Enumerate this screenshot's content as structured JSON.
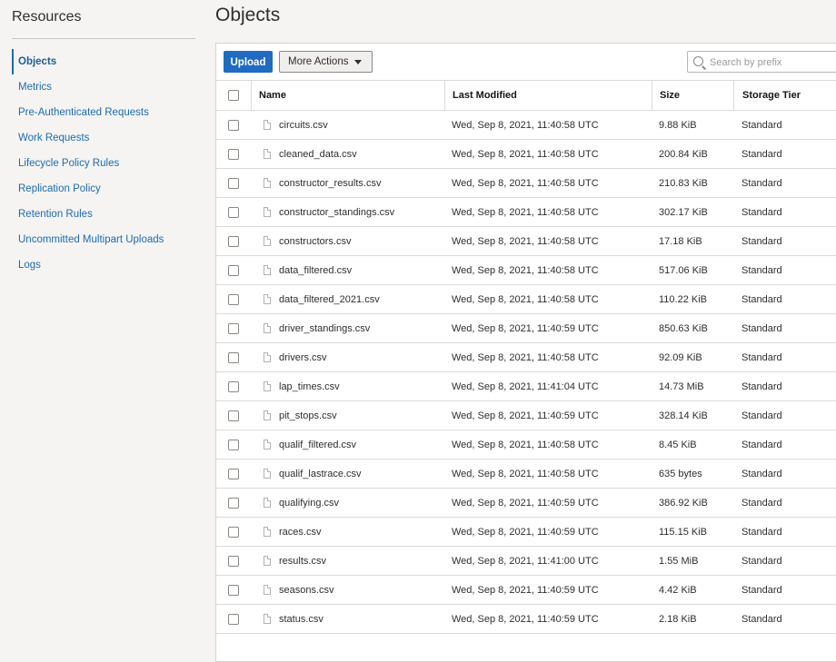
{
  "sidebar": {
    "title": "Resources",
    "items": [
      {
        "label": "Objects"
      },
      {
        "label": "Metrics"
      },
      {
        "label": "Pre-Authenticated Requests"
      },
      {
        "label": "Work Requests"
      },
      {
        "label": "Lifecycle Policy Rules"
      },
      {
        "label": "Replication Policy"
      },
      {
        "label": "Retention Rules"
      },
      {
        "label": "Uncommitted Multipart Uploads"
      },
      {
        "label": "Logs"
      }
    ],
    "active_index": 0
  },
  "main": {
    "title": "Objects",
    "toolbar": {
      "upload_label": "Upload",
      "more_actions_label": "More Actions",
      "search_placeholder": "Search by prefix"
    },
    "table": {
      "columns": [
        "Name",
        "Last Modified",
        "Size",
        "Storage Tier"
      ],
      "rows": [
        {
          "name": "circuits.csv",
          "modified": "Wed, Sep 8, 2021, 11:40:58 UTC",
          "size": "9.88 KiB",
          "tier": "Standard"
        },
        {
          "name": "cleaned_data.csv",
          "modified": "Wed, Sep 8, 2021, 11:40:58 UTC",
          "size": "200.84 KiB",
          "tier": "Standard"
        },
        {
          "name": "constructor_results.csv",
          "modified": "Wed, Sep 8, 2021, 11:40:58 UTC",
          "size": "210.83 KiB",
          "tier": "Standard"
        },
        {
          "name": "constructor_standings.csv",
          "modified": "Wed, Sep 8, 2021, 11:40:58 UTC",
          "size": "302.17 KiB",
          "tier": "Standard"
        },
        {
          "name": "constructors.csv",
          "modified": "Wed, Sep 8, 2021, 11:40:58 UTC",
          "size": "17.18 KiB",
          "tier": "Standard"
        },
        {
          "name": "data_filtered.csv",
          "modified": "Wed, Sep 8, 2021, 11:40:58 UTC",
          "size": "517.06 KiB",
          "tier": "Standard"
        },
        {
          "name": "data_filtered_2021.csv",
          "modified": "Wed, Sep 8, 2021, 11:40:58 UTC",
          "size": "110.22 KiB",
          "tier": "Standard"
        },
        {
          "name": "driver_standings.csv",
          "modified": "Wed, Sep 8, 2021, 11:40:59 UTC",
          "size": "850.63 KiB",
          "tier": "Standard"
        },
        {
          "name": "drivers.csv",
          "modified": "Wed, Sep 8, 2021, 11:40:58 UTC",
          "size": "92.09 KiB",
          "tier": "Standard"
        },
        {
          "name": "lap_times.csv",
          "modified": "Wed, Sep 8, 2021, 11:41:04 UTC",
          "size": "14.73 MiB",
          "tier": "Standard"
        },
        {
          "name": "pit_stops.csv",
          "modified": "Wed, Sep 8, 2021, 11:40:59 UTC",
          "size": "328.14 KiB",
          "tier": "Standard"
        },
        {
          "name": "qualif_filtered.csv",
          "modified": "Wed, Sep 8, 2021, 11:40:58 UTC",
          "size": "8.45 KiB",
          "tier": "Standard"
        },
        {
          "name": "qualif_lastrace.csv",
          "modified": "Wed, Sep 8, 2021, 11:40:58 UTC",
          "size": "635 bytes",
          "tier": "Standard"
        },
        {
          "name": "qualifying.csv",
          "modified": "Wed, Sep 8, 2021, 11:40:59 UTC",
          "size": "386.92 KiB",
          "tier": "Standard"
        },
        {
          "name": "races.csv",
          "modified": "Wed, Sep 8, 2021, 11:40:59 UTC",
          "size": "115.15 KiB",
          "tier": "Standard"
        },
        {
          "name": "results.csv",
          "modified": "Wed, Sep 8, 2021, 11:41:00 UTC",
          "size": "1.55 MiB",
          "tier": "Standard"
        },
        {
          "name": "seasons.csv",
          "modified": "Wed, Sep 8, 2021, 11:40:59 UTC",
          "size": "4.42 KiB",
          "tier": "Standard"
        },
        {
          "name": "status.csv",
          "modified": "Wed, Sep 8, 2021, 11:40:59 UTC",
          "size": "2.18 KiB",
          "tier": "Standard"
        }
      ]
    }
  },
  "colors": {
    "accent": "#1f6bc1",
    "link": "#1f6bae",
    "background": "#f5f4f2"
  },
  "icons": {
    "search": "search-icon",
    "file": "file-icon",
    "caret": "chevron-down-icon"
  }
}
